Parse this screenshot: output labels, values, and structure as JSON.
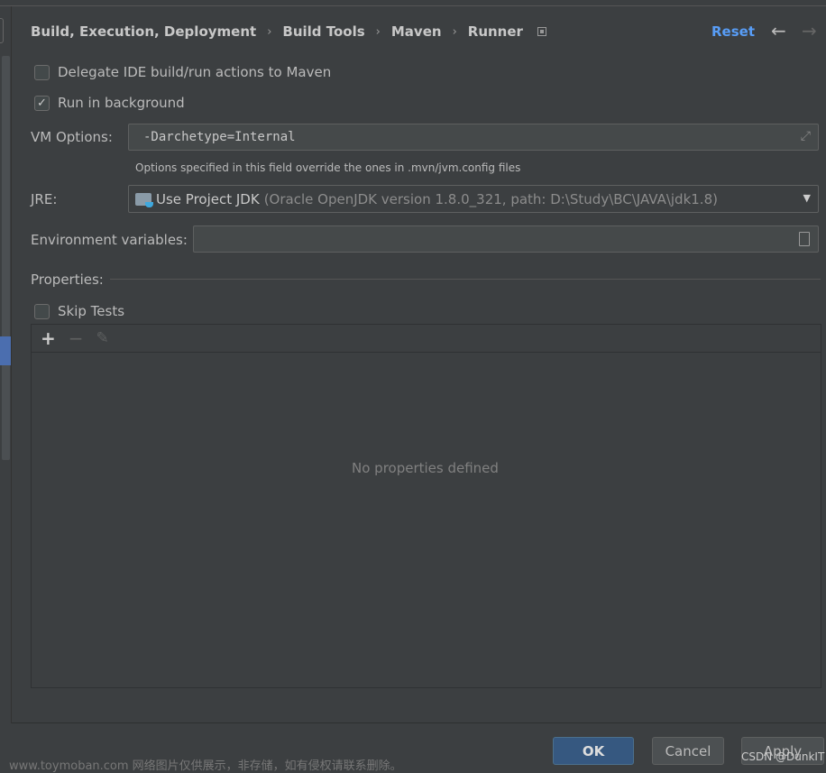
{
  "breadcrumb": [
    "Build, Execution, Deployment",
    "Build Tools",
    "Maven",
    "Runner"
  ],
  "header": {
    "reset": "Reset",
    "back_icon": "arrow-left",
    "forward_icon": "arrow-right"
  },
  "options": {
    "delegate": {
      "label": "Delegate IDE build/run actions to Maven",
      "checked": false
    },
    "background": {
      "label": "Run in background",
      "checked": true
    },
    "vm_label": "VM Options:",
    "vm_value": "-Darchetype=Internal",
    "vm_hint": "Options specified in this field override the ones in .mvn/jvm.config files",
    "jre_label": "JRE:",
    "jre_value": "Use Project JDK",
    "jre_detail": "(Oracle OpenJDK version 1.8.0_321, path: D:\\Study\\BC\\JAVA\\jdk1.8)",
    "env_label": "Environment variables:",
    "env_value": "",
    "properties_label": "Properties:",
    "skip_tests": {
      "label": "Skip Tests",
      "checked": false
    },
    "empty_text": "No properties defined"
  },
  "buttons": {
    "ok": "OK",
    "cancel": "Cancel",
    "apply": "Apply"
  },
  "watermarks": {
    "site": "www.toymoban.com 网络图片仅供展示，非存储，如有侵权请联系删除。",
    "author": "CSDN @DunkIT"
  },
  "colors": {
    "accent": "#589df6",
    "ok_button": "#365880"
  }
}
